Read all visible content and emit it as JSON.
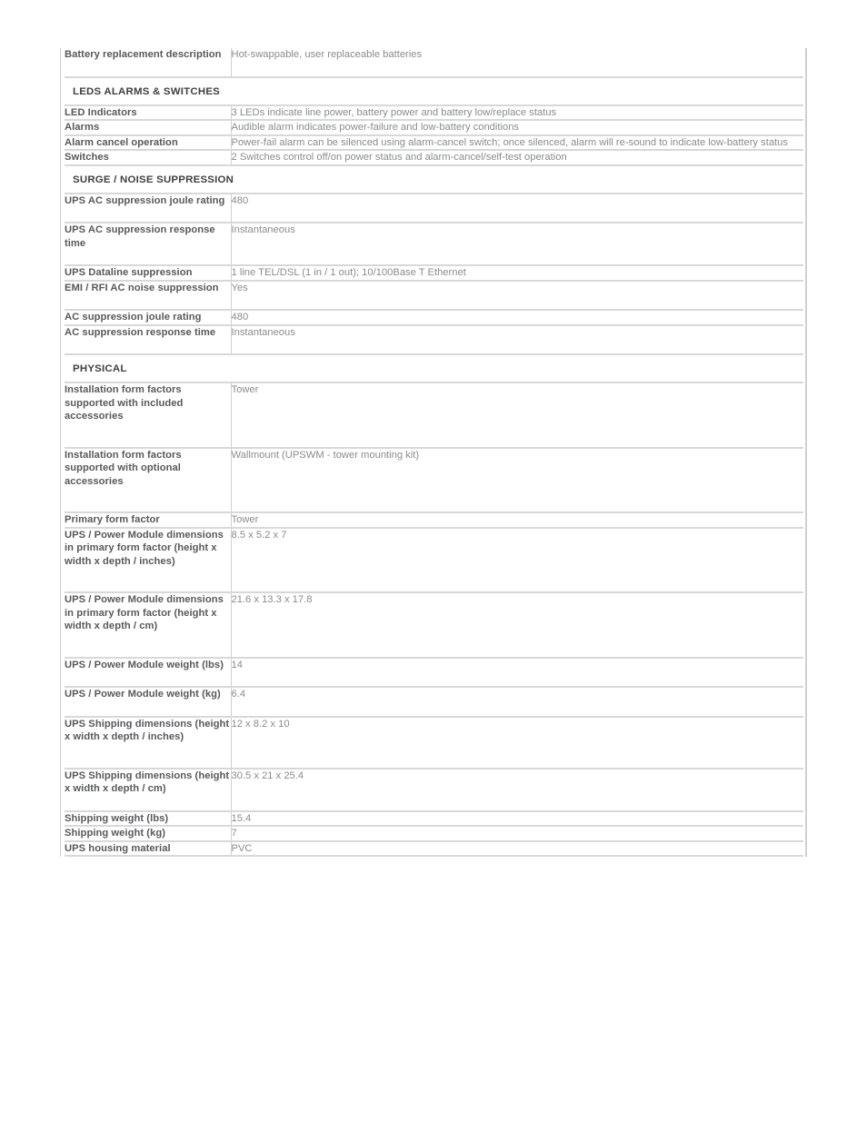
{
  "document": {
    "type": "product-specification-table",
    "colors": {
      "page_background": "#ffffff",
      "label_text": "#58595b",
      "value_text": "#8a8c8e",
      "section_text": "#3f4042",
      "rule": "#d8d8d8",
      "frame": "#cfcfcf"
    }
  },
  "rows": [
    {
      "kind": "spec",
      "label": "Battery replacement description",
      "value": "Hot-swappable, user replaceable batteries",
      "size": "l"
    },
    {
      "kind": "section",
      "label": "LEDS ALARMS & SWITCHES"
    },
    {
      "kind": "spec",
      "label": "LED Indicators",
      "value": "3 LEDs indicate line power, battery power and battery low/replace status",
      "size": "s"
    },
    {
      "kind": "spec",
      "label": "Alarms",
      "value": "Audible alarm indicates power-failure and low-battery conditions",
      "size": "s"
    },
    {
      "kind": "spec",
      "label": "Alarm cancel operation",
      "value": "Power-fail alarm can be silenced using alarm-cancel switch; once silenced, alarm will re-sound to indicate low-battery status",
      "size": "s"
    },
    {
      "kind": "spec",
      "label": "Switches",
      "value": "2 Switches control off/on power status and alarm-cancel/self-test operation",
      "size": "s"
    },
    {
      "kind": "section",
      "label": "SURGE / NOISE SUPPRESSION"
    },
    {
      "kind": "spec",
      "label": "UPS AC suppression joule rating",
      "value": "480",
      "size": "l"
    },
    {
      "kind": "spec",
      "label": "UPS AC suppression response time",
      "value": "Instantaneous",
      "size": "l"
    },
    {
      "kind": "spec",
      "label": "UPS Dataline suppression",
      "value": "1 line TEL/DSL (1 in / 1 out); 10/100Base T Ethernet",
      "size": "s"
    },
    {
      "kind": "spec",
      "label": "EMI / RFI AC noise suppression",
      "value": "Yes",
      "size": "l"
    },
    {
      "kind": "spec",
      "label": "AC suppression joule rating",
      "value": "480",
      "size": "s"
    },
    {
      "kind": "spec",
      "label": "AC suppression response time",
      "value": "Instantaneous",
      "size": "l"
    },
    {
      "kind": "section",
      "label": "PHYSICAL"
    },
    {
      "kind": "spec",
      "label": "Installation form factors supported with included accessories",
      "value": "Tower",
      "size": "xl"
    },
    {
      "kind": "spec",
      "label": "Installation form factors supported with optional accessories",
      "value": "Wallmount (UPSWM - tower mounting kit)",
      "size": "xl"
    },
    {
      "kind": "spec",
      "label": "Primary form factor",
      "value": "Tower",
      "size": "s"
    },
    {
      "kind": "spec",
      "label": "UPS / Power Module dimensions in primary form factor (height x width x depth / inches)",
      "value": "8.5 x 5.2 x 7",
      "size": "xxl"
    },
    {
      "kind": "spec",
      "label": "UPS / Power Module dimensions in primary form factor (height x width x depth / cm)",
      "value": "21.6 x 13.3 x 17.8",
      "size": "xxl"
    },
    {
      "kind": "spec",
      "label": "UPS / Power Module weight (lbs)",
      "value": "14",
      "size": "l"
    },
    {
      "kind": "spec",
      "label": "UPS / Power Module weight (kg)",
      "value": "6.4",
      "size": "l"
    },
    {
      "kind": "spec",
      "label": "UPS Shipping dimensions (height x width x depth / inches)",
      "value": "12 x 8.2 x 10",
      "size": "xl"
    },
    {
      "kind": "spec",
      "label": "UPS Shipping dimensions (height x width x depth / cm)",
      "value": "30.5 x 21 x 25.4",
      "size": "l"
    },
    {
      "kind": "spec",
      "label": "Shipping weight (lbs)",
      "value": "15.4",
      "size": "s"
    },
    {
      "kind": "spec",
      "label": "Shipping weight (kg)",
      "value": "7",
      "size": "s"
    },
    {
      "kind": "spec",
      "label": "UPS housing material",
      "value": "PVC",
      "size": "s"
    }
  ]
}
